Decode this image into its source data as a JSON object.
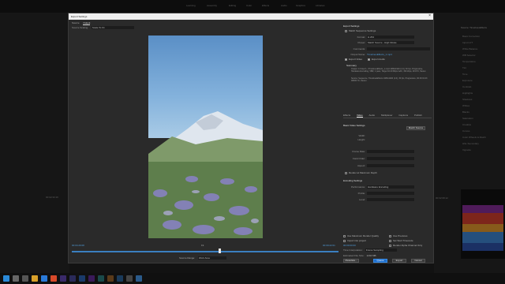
{
  "background_app": {
    "workspace_tabs": [
      "Learning",
      "Assembly",
      "Editing",
      "Color",
      "Effects",
      "Audio",
      "Graphics",
      "Libraries",
      "Editing"
    ],
    "right_panel_title": "Source: TimelinesEffects",
    "right_panel_items": [
      "Basic Correction",
      "Input LUT",
      "White Balance",
      "WB Selector",
      "Temperature",
      "Tint",
      "Tone",
      "Exposure",
      "Contrast",
      "Highlights",
      "Shadows",
      "Whites",
      "Blacks",
      "Saturation",
      "Creative",
      "Curves",
      "Color Wheels & Match",
      "HSL Secondary",
      "Vignette"
    ],
    "left_timecode": "00:02:33:16",
    "right_timecode": "00:02:08:12"
  },
  "dialog": {
    "title": "Export Settings",
    "close_glyph": "×",
    "tabs": [
      "Source",
      "Output"
    ],
    "active_tab": "Output",
    "source_scaling_label": "Source Scaling:",
    "source_scaling_value": "Scale To Fit",
    "timecode_in": "00:04:29:08",
    "timecode_out": "00:09:22:01",
    "fit_label": "Fit",
    "source_range_label": "Source Range:",
    "source_range_value": "Work Area"
  },
  "export_settings": {
    "header": "Export Settings",
    "match_sequence": "Match Sequence Settings",
    "format_label": "Format:",
    "format_value": "H.264",
    "preset_label": "Preset:",
    "preset_value": "Match Source - High bitrate",
    "comments_label": "Comments:",
    "comments_value": "",
    "output_name_label": "Output Name:",
    "output_name_value": "TimelinesEffects_1.mp4",
    "export_video": "Export Video",
    "export_audio": "Export Audio",
    "summary_header": "Summary",
    "summary_output": "Output: C:\\Users\\...\\TimelinesEffects_1.mp4 1080x1920 (1.0), 30 fps, Progressive, Hardware Encoding, VBR, 1 pass, Target 10.00 Mbps AAC, 320 kbps, 48 kHz, Stereo",
    "summary_source": "Source: Sequence, TimelinesEffects 1080x1920 (1.0), 30 fps, Progressive, 00:16:31:23 48000 Hz, Stereo"
  },
  "settings_tabs": [
    "Effects",
    "Video",
    "Audio",
    "Multiplexer",
    "Captions",
    "Publish"
  ],
  "active_settings_tab": "Video",
  "video": {
    "basic_header": "Basic Video Settings",
    "match_source_btn": "Match Source",
    "width_label": "Width:",
    "height_label": "Height:",
    "frame_rate_label": "Frame Rate:",
    "field_order_label": "Field Order:",
    "aspect_label": "Aspect:",
    "render_max_depth": "Render at Maximum Depth",
    "encoding_header": "Encoding Settings",
    "performance_label": "Performance:",
    "performance_value": "Hardware Encoding",
    "profile_label": "Profile:",
    "level_label": "Level:"
  },
  "bottom_options": {
    "use_max_render": "Use Maximum Render Quality",
    "use_previews": "Use Previews",
    "import_into_project": "Import into project",
    "set_start_timecode": "Set Start Timecode",
    "start_timecode": "00:00:00:00",
    "render_alpha": "Render Alpha Channel Only",
    "time_interpolation_label": "Time Interpolation:",
    "time_interpolation_value": "Frame Sampling",
    "file_size_label": "Estimated File Size:",
    "file_size_value": "1204 MB",
    "metadata_btn": "Metadata...",
    "queue_btn": "Queue",
    "export_btn": "Export",
    "cancel_btn": "Cancel"
  },
  "colors": {
    "accent_blue": "#1c6fd0",
    "timecode_blue": "#4f9bd8",
    "dialog_bg": "#2a2a2a"
  },
  "taskbar_icons": [
    "windows-start",
    "search",
    "task-view",
    "file-explorer",
    "edge",
    "chrome",
    "premiere-pro",
    "media-encoder",
    "photoshop",
    "after-effects",
    "audition",
    "illustrator",
    "lightroom",
    "store",
    "mail"
  ]
}
